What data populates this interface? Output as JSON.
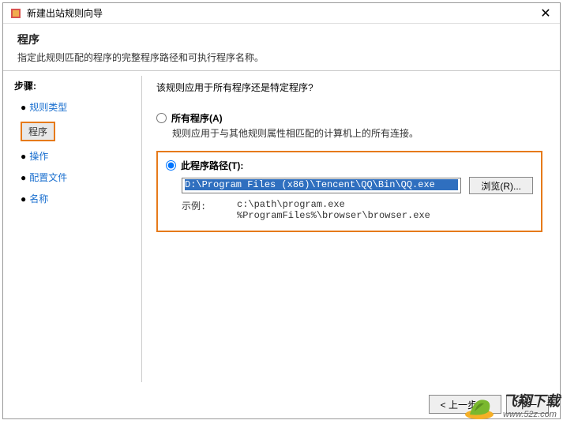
{
  "window": {
    "title": "新建出站规则向导",
    "close": "✕"
  },
  "header": {
    "title": "程序",
    "desc": "指定此规则匹配的程序的完整程序路径和可执行程序名称。"
  },
  "sidebar": {
    "label": "步骤:",
    "items": [
      {
        "label": "规则类型"
      },
      {
        "label": "程序"
      },
      {
        "label": "操作"
      },
      {
        "label": "配置文件"
      },
      {
        "label": "名称"
      }
    ]
  },
  "content": {
    "question": "该规则应用于所有程序还是特定程序?",
    "optAll": {
      "label": "所有程序(A)",
      "desc": "规则应用于与其他规则属性相匹配的计算机上的所有连接。"
    },
    "optPath": {
      "label": "此程序路径(T):",
      "value": "D:\\Program Files (x86)\\Tencent\\QQ\\Bin\\QQ.exe",
      "browse": "浏览(R)...",
      "exampleLabel": "示例:",
      "examplePaths": "c:\\path\\program.exe\n%ProgramFiles%\\browser\\browser.exe"
    }
  },
  "footer": {
    "back": "< 上一步(B)",
    "next": "下一"
  },
  "watermark": {
    "brand": "飞翔下载",
    "url": "www.52z.com"
  }
}
